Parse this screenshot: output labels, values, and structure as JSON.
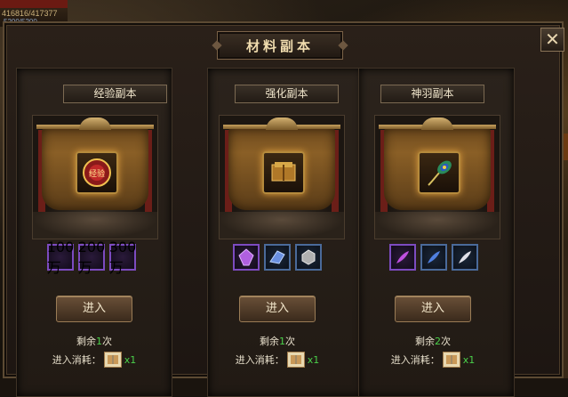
{
  "hud": {
    "hp_text": "416816/417377",
    "mp_text": "5200/5200"
  },
  "window": {
    "title": "材料副本",
    "close_label": "✕"
  },
  "cards": [
    {
      "title": "经验副本",
      "emblem_label": "经验",
      "emblem": "exp-emblem-icon",
      "items": [
        {
          "icon": "gold-ingot-icon",
          "label": "100万"
        },
        {
          "icon": "gold-ingot-icon",
          "label": "200万"
        },
        {
          "icon": "gold-ingot-icon",
          "label": "300万"
        }
      ],
      "enter_label": "进入",
      "remain_prefix": "剩余",
      "remain_count": "1",
      "remain_suffix": "次",
      "cost_label": "进入消耗：",
      "cost_qty": "x1"
    },
    {
      "title": "强化副本",
      "emblem": "book-icon",
      "items": [
        {
          "icon": "purple-crystal-icon"
        },
        {
          "icon": "blue-crystal-icon"
        },
        {
          "icon": "stone-icon"
        }
      ],
      "enter_label": "进入",
      "remain_prefix": "剩余",
      "remain_count": "1",
      "remain_suffix": "次",
      "cost_label": "进入消耗：",
      "cost_qty": "x1"
    },
    {
      "title": "神羽副本",
      "emblem": "peacock-feather-icon",
      "items": [
        {
          "icon": "purple-feather-icon"
        },
        {
          "icon": "blue-feather-icon"
        },
        {
          "icon": "white-feather-icon"
        }
      ],
      "enter_label": "进入",
      "remain_prefix": "剩余",
      "remain_count": "2",
      "remain_suffix": "次",
      "cost_label": "进入消耗：",
      "cost_qty": "x1"
    }
  ],
  "colors": {
    "accent_green": "#4ad04a",
    "purple_border": "#7c4bc0",
    "blue_border": "#4a6a9a"
  }
}
